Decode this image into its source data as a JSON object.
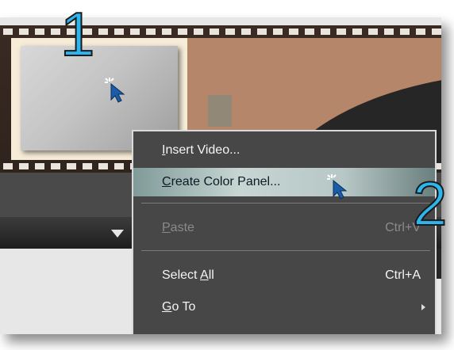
{
  "callouts": {
    "first": "1",
    "second": "2"
  },
  "timeline": {
    "expand_icon": "triangle-down-icon"
  },
  "context_menu": {
    "items": [
      {
        "label": "Insert Video...",
        "mnemonic": "I",
        "shortcut": "",
        "state": "normal"
      },
      {
        "label": "Create Color Panel...",
        "mnemonic": "C",
        "shortcut": "",
        "state": "highlighted"
      },
      {
        "label": "Paste",
        "mnemonic": "P",
        "shortcut": "Ctrl+V",
        "state": "disabled"
      },
      {
        "label": "Select All",
        "mnemonic": "A",
        "shortcut": "Ctrl+A",
        "state": "normal"
      },
      {
        "label": "Go To",
        "mnemonic": "G",
        "shortcut": "",
        "state": "normal",
        "submenu": true
      }
    ]
  },
  "colors": {
    "callout": "#2cb6ef",
    "menu_background": "#474747",
    "highlight": "#c7d6d3",
    "clip_background": "#b5866a"
  },
  "icons": {
    "pointer": "mouse-cursor-click-icon",
    "submenu": "submenu-arrow-icon"
  }
}
